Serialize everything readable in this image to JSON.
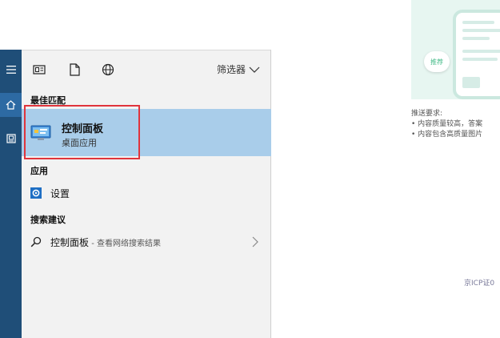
{
  "toolbar": {
    "icons": [
      "document-grid-icon",
      "file-icon",
      "globe-icon"
    ],
    "filter_label": "筛选器"
  },
  "best_match": {
    "section_label": "最佳匹配",
    "title": "控制面板",
    "subtitle": "桌面应用"
  },
  "apps": {
    "section_label": "应用",
    "items": [
      {
        "label": "设置"
      }
    ]
  },
  "suggestions": {
    "section_label": "搜索建议",
    "items": [
      {
        "label": "控制面板",
        "hint": " - 查看网络搜索结果"
      }
    ]
  },
  "background_page": {
    "badge": "推荐",
    "requirements_title": "推送要求:",
    "requirements": [
      "• 内容质量较高，答案",
      "• 内容包含高质量图片"
    ],
    "footer": "京ICP证0"
  },
  "colors": {
    "rail": "#1f4e78",
    "highlight": "#a9cdea",
    "annotation": "#e0343c"
  }
}
